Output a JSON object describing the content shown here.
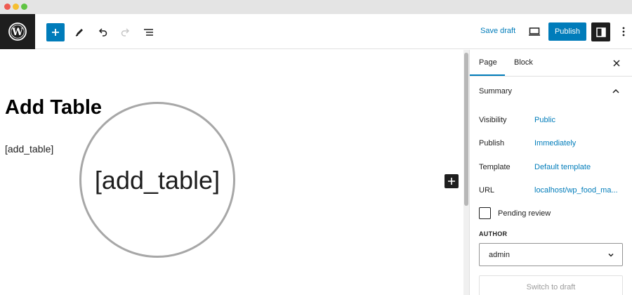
{
  "toolbar": {
    "save_draft": "Save draft",
    "publish": "Publish",
    "icons": [
      "wordpress-logo",
      "plus-icon",
      "pencil-icon",
      "undo-icon",
      "redo-icon",
      "list-view-icon",
      "desktop-preview-icon",
      "sidebar-toggle-icon",
      "more-options-icon"
    ]
  },
  "editor": {
    "title": "Add Table",
    "shortcode": "[add_table]",
    "magnified_text": "[add_table]"
  },
  "sidebar": {
    "tabs": [
      {
        "label": "Page",
        "active": true
      },
      {
        "label": "Block",
        "active": false
      }
    ],
    "summary": {
      "title": "Summary",
      "rows": [
        {
          "label": "Visibility",
          "value": "Public"
        },
        {
          "label": "Publish",
          "value": "Immediately"
        },
        {
          "label": "Template",
          "value": "Default template"
        },
        {
          "label": "URL",
          "value": "localhost/wp_food_ma..."
        }
      ],
      "pending_review": "Pending review",
      "author_label": "AUTHOR",
      "author_value": "admin",
      "switch_to_draft": "Switch to draft"
    }
  },
  "colors": {
    "accent": "#007cba",
    "dark": "#1e1e1e",
    "border": "#e0e0e0"
  }
}
